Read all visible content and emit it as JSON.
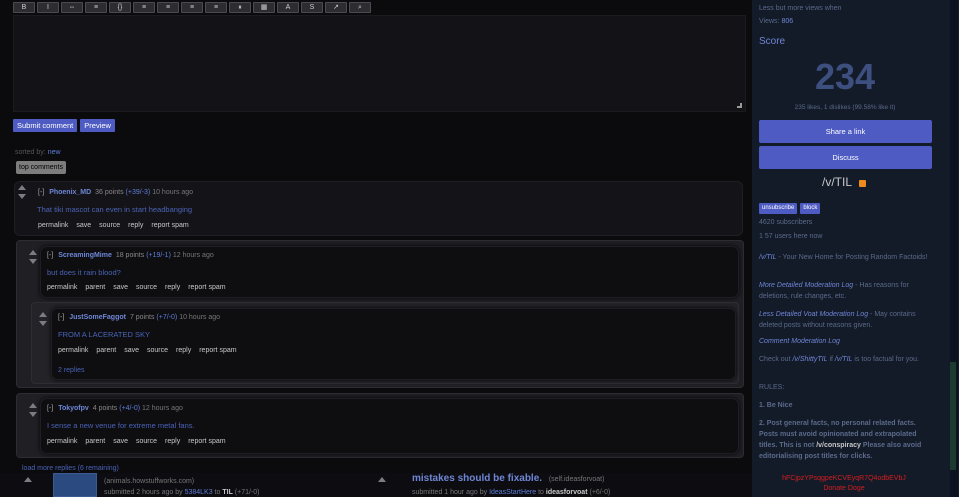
{
  "toolbar": {
    "buttons": [
      {
        "label": "B",
        "icon": "bold-icon"
      },
      {
        "label": "I",
        "icon": "italic-icon"
      },
      {
        "label": "⇔",
        "icon": "link-icon"
      },
      {
        "label": "≡",
        "icon": "quote-icon"
      },
      {
        "label": "{}",
        "icon": "code-icon"
      },
      {
        "label": "≡",
        "icon": "bullet-list-icon"
      },
      {
        "label": "≡",
        "icon": "numbered-list-icon"
      },
      {
        "label": "≡",
        "icon": "heading-icon"
      },
      {
        "label": "≡",
        "icon": "hr-icon"
      },
      {
        "label": "⏸",
        "icon": "pause-icon"
      },
      {
        "label": "▦",
        "icon": "table-icon"
      },
      {
        "label": "A",
        "icon": "font-icon"
      },
      {
        "label": "S",
        "icon": "strike-icon"
      },
      {
        "label": "↗",
        "icon": "expand-icon"
      },
      {
        "label": "⌕",
        "icon": "search-icon"
      }
    ]
  },
  "comment_form": {
    "submit_label": "Submit comment",
    "preview_label": "Preview"
  },
  "sort": {
    "prefix": "sorted by:",
    "value": "new"
  },
  "top_comments_label": "top comments",
  "comments": [
    {
      "toggle": "[-]",
      "author": "Phoenix_MD",
      "score": "36 points",
      "votes": "(+39/-3)",
      "age": "10 hours ago",
      "text": "That tiki mascot can even in start headbanging",
      "actions": [
        "permalink",
        "save",
        "source",
        "reply",
        "report spam"
      ]
    },
    {
      "toggle": "[-]",
      "author": "ScreamingMime",
      "score": "18 points",
      "votes": "(+19/-1)",
      "age": "12 hours ago",
      "text": "but does it rain blood?",
      "actions": [
        "permalink",
        "parent",
        "save",
        "source",
        "reply",
        "report spam"
      ]
    },
    {
      "toggle": "[-]",
      "author": "JustSomeFaggot",
      "score": "7 points",
      "votes": "(+7/-0)",
      "age": "10 hours ago",
      "text": "FROM A LACERATED SKY",
      "actions": [
        "permalink",
        "parent",
        "save",
        "source",
        "reply",
        "report spam"
      ],
      "more": "2 replies"
    },
    {
      "toggle": "[-]",
      "author": "Tokyofpv",
      "score": "4 points",
      "votes": "(+4/-0)",
      "age": "12 hours ago",
      "text": "I sense a new venue for extreme metal fans.",
      "actions": [
        "permalink",
        "parent",
        "save",
        "source",
        "reply",
        "report spam"
      ]
    }
  ],
  "load_more": "load more replies (6 remaining)",
  "bottom": {
    "left_domain": "(animals.howstuffworks.com)",
    "left_submitted": "submitted 2 hours ago by",
    "left_user": "5384LK3",
    "left_to": "to",
    "left_sub": "TIL",
    "left_votes": "(+71/-0)",
    "right_title": "mistakes should be fixable.",
    "right_domain": "(self.ideasforvoat)",
    "right_submitted": "submitted 1 hour ago by",
    "right_user": "IdeasStartHere",
    "right_to": "to",
    "right_sub": "ideasforvoat",
    "right_votes": "(+6/-0)"
  },
  "sidebar": {
    "top_line1": "Less but more views when",
    "top_line2": "Views:",
    "top_views": "806",
    "score_heading": "Score",
    "score_value": "234",
    "score_detail": "235 likes, 1 dislikes (99.58% like it)",
    "share_label": "Share a link",
    "discuss_label": "Discuss",
    "subverse": "/v/TIL",
    "unsubscribe_label": "unsubscribe",
    "block_label": "block",
    "subscribers": "4620 subscribers",
    "online": "1 57 users here now",
    "tagline_link": "/v/TIL",
    "tagline": "- Your New Home for Posting Random Factoids!",
    "link1": "More Detailed Moderation Log",
    "link1_rest": "- Has reasons for deletions, rule changes, etc.",
    "link2": "Less Detailed Voat Moderation Log",
    "link2_rest": "- May contains deleted posts without reasons given.",
    "link3": "Comment Moderation Log",
    "checkout_prefix": "Check out",
    "checkout_link": "/v/ShittyTIL",
    "checkout_mid": "if",
    "checkout_link2": "/v/TIL",
    "checkout_end": "is too factual for you.",
    "rules_heading": "RULES:",
    "rule1": "1. Be Nice",
    "rule2": "2. Post general facts, no personal related facts. Posts must avoid opinionated and extrapolated titles. This is not",
    "rule2_em": "/v/conspiracy",
    "rule2_end": "Please also avoid editorialising post titles for clicks.",
    "red_line1": "hFCjpzYPsqgpeKCVEyqR7Q4odbEVbJ",
    "red_line2": "Donate Doge"
  },
  "colors": {
    "accent": "#4e5bc2",
    "link": "#6f86d6",
    "background": "#0b0b0e",
    "sidebar": "#131a28",
    "warning": "#d21f1f"
  }
}
